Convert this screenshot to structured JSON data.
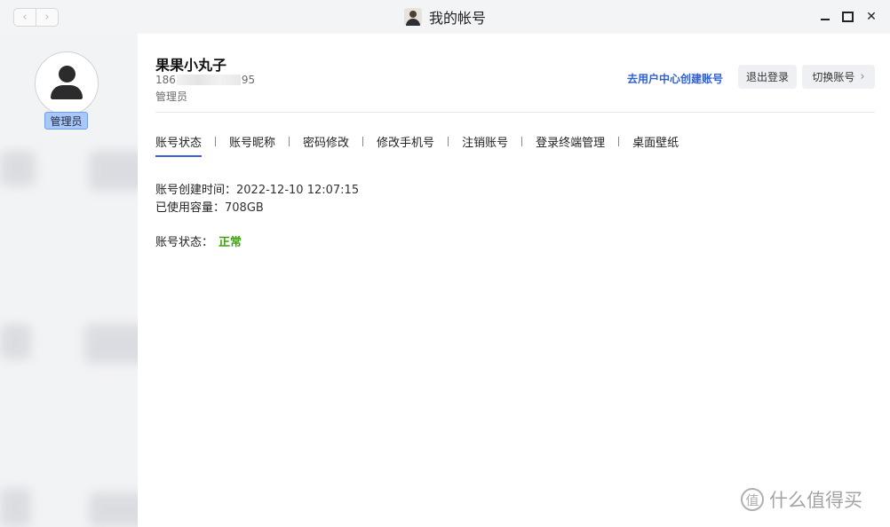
{
  "window": {
    "title": "我的帐号"
  },
  "sidebar": {
    "role_badge": "管理员"
  },
  "account": {
    "username": "果果小丸子",
    "phone_prefix": "186",
    "phone_suffix": "95",
    "role": "管理员"
  },
  "actions": {
    "create_link": "去用户中心创建账号",
    "logout": "退出登录",
    "switch": "切换账号"
  },
  "tabs": [
    {
      "label": "账号状态",
      "active": true
    },
    {
      "label": "账号昵称",
      "active": false
    },
    {
      "label": "密码修改",
      "active": false
    },
    {
      "label": "修改手机号",
      "active": false
    },
    {
      "label": "注销账号",
      "active": false
    },
    {
      "label": "登录终端管理",
      "active": false
    },
    {
      "label": "桌面壁纸",
      "active": false
    }
  ],
  "details": {
    "created_label": "账号创建时间：",
    "created_value": "2022-12-10 12:07:15",
    "storage_label": "已使用容量：",
    "storage_value": "708GB",
    "status_label": "账号状态：",
    "status_value": "正常"
  },
  "watermark": {
    "text": "什么值得买",
    "icon_glyph": "值"
  },
  "colors": {
    "accent": "#3f5ed3",
    "link": "#2f5fd6",
    "status_ok": "#3fa10f",
    "badge_bg": "#a9c8f7"
  }
}
